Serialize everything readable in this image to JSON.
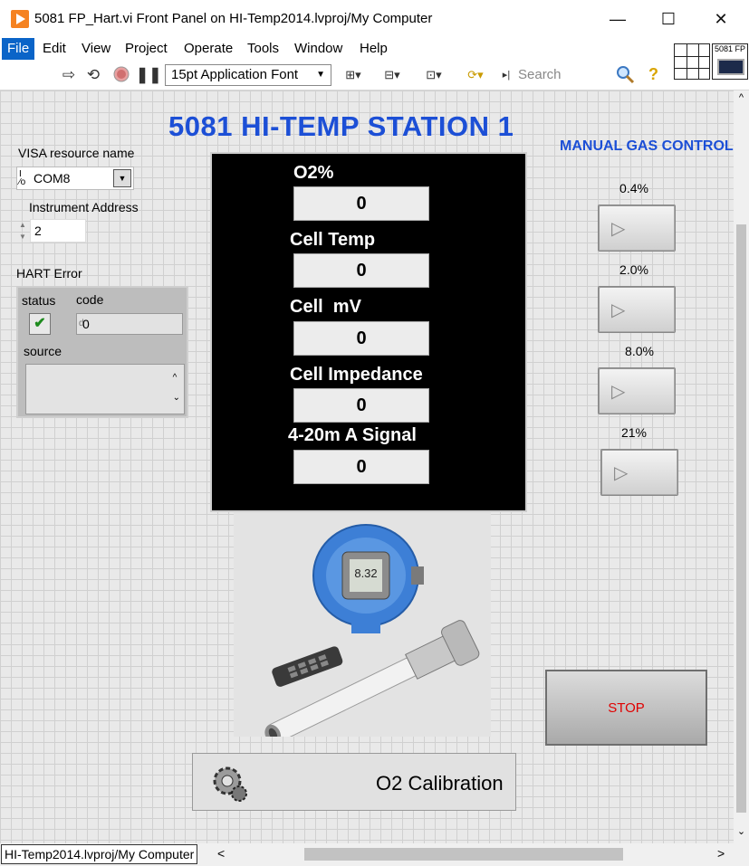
{
  "window": {
    "title": "5081 FP_Hart.vi Front Panel on HI-Temp2014.lvproj/My Computer",
    "minimize": "—",
    "maximize": "☐",
    "close": "✕"
  },
  "menu": [
    "File",
    "Edit",
    "View",
    "Project",
    "Operate",
    "Tools",
    "Window",
    "Help"
  ],
  "toolbar": {
    "font": "15pt Application Font",
    "search_placeholder": "Search",
    "vi_icon_label": "5081 FP"
  },
  "panel": {
    "station_title": "5081 HI-TEMP STATION 1",
    "visa": {
      "label": "VISA resource name",
      "value": "COM8",
      "prefix": "I/O"
    },
    "address": {
      "label": "Instrument Address",
      "value": "2"
    },
    "hart_error": {
      "label": "HART Error",
      "status_label": "status",
      "code_label": "code",
      "code_value": "0",
      "source_label": "source",
      "source_value": "",
      "status_ok": true
    },
    "indicators": [
      {
        "label": "O2%",
        "value": "0"
      },
      {
        "label": "Cell Temp",
        "value": "0"
      },
      {
        "label": "Cell  mV",
        "value": "0"
      },
      {
        "label": "Cell Impedance",
        "value": "0"
      },
      {
        "label": "4-20m A Signal",
        "value": "0"
      }
    ],
    "gas_control": {
      "title": "MANUAL GAS CONTROL",
      "buttons": [
        {
          "label": "0.4%"
        },
        {
          "label": "2.0%"
        },
        {
          "label": "8.0%"
        },
        {
          "label": "21%"
        }
      ]
    },
    "stop_label": "STOP",
    "calibration_label": "O2 Calibration",
    "device_display_reading": "8.32"
  },
  "status": {
    "path": "HI-Temp2014.lvproj/My Computer"
  },
  "colors": {
    "title_blue": "#1c4fd6",
    "stop_red": "#e00000",
    "menu_active": "#0a64c8"
  }
}
